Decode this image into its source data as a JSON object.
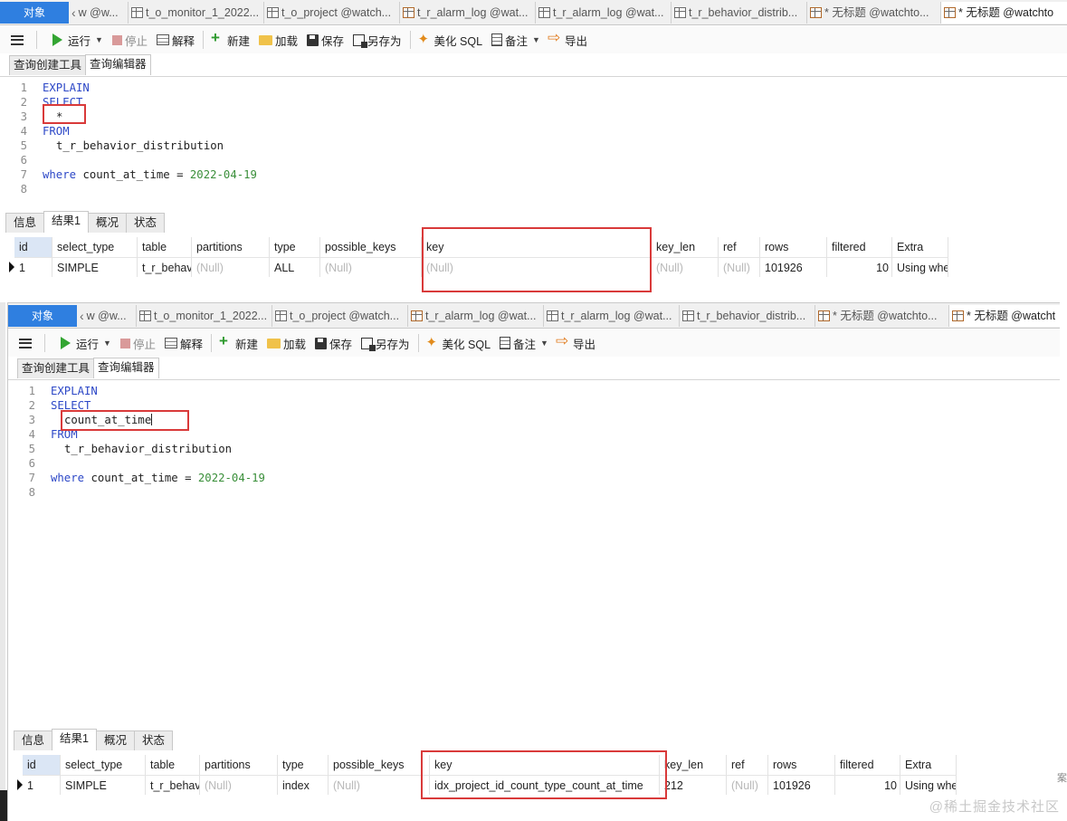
{
  "panel_top": {
    "object_tab": "对象",
    "tabs": [
      {
        "label": "w @w...",
        "icon": "back-chevron-icon"
      },
      {
        "label": "t_o_monitor_1_2022...",
        "icon": "table-icon"
      },
      {
        "label": "t_o_project @watch...",
        "icon": "table-icon"
      },
      {
        "label": "t_r_alarm_log @wat...",
        "icon": "query-icon"
      },
      {
        "label": "t_r_alarm_log @wat...",
        "icon": "table-icon"
      },
      {
        "label": "t_r_behavior_distrib...",
        "icon": "table-icon"
      },
      {
        "label": "* 无标题 @watchto...",
        "icon": "query-icon"
      },
      {
        "label": "* 无标题 @watchto",
        "icon": "query-icon"
      }
    ],
    "toolbar": {
      "run": "运行",
      "stop": "停止",
      "explain": "解释",
      "new": "新建",
      "load": "加载",
      "save": "保存",
      "save_as": "另存为",
      "beautify": "美化 SQL",
      "note": "备注",
      "export": "导出"
    },
    "sub_tabs": [
      "查询创建工具",
      "查询编辑器"
    ],
    "code": {
      "l1": "EXPLAIN",
      "l2": "SELECT",
      "l3": "*",
      "l4": "FROM",
      "l5": "t_r_behavior_distribution",
      "l7_kw": "where",
      "l7_col": "count_at_time =",
      "l7_date": "2022-04-19"
    },
    "line_numbers": [
      "1",
      "2",
      "3",
      "4",
      "5",
      "6",
      "7",
      "8"
    ],
    "result_tabs": [
      "信息",
      "结果1",
      "概况",
      "状态"
    ],
    "columns": [
      "id",
      "select_type",
      "table",
      "partitions",
      "type",
      "possible_keys",
      "key",
      "key_len",
      "ref",
      "rows",
      "filtered",
      "Extra"
    ],
    "row": {
      "id": "1",
      "select_type": "SIMPLE",
      "table": "t_r_behavi",
      "partitions": "(Null)",
      "type": "ALL",
      "possible_keys": "(Null)",
      "key": "(Null)",
      "key_len": "(Null)",
      "ref": "(Null)",
      "rows": "101926",
      "filtered": "10",
      "extra": "Using whe"
    }
  },
  "panel_bottom": {
    "object_tab": "对象",
    "tabs": [
      {
        "label": "w @w...",
        "icon": "back-chevron-icon"
      },
      {
        "label": "t_o_monitor_1_2022...",
        "icon": "table-icon"
      },
      {
        "label": "t_o_project @watch...",
        "icon": "table-icon"
      },
      {
        "label": "t_r_alarm_log @wat...",
        "icon": "query-icon"
      },
      {
        "label": "t_r_alarm_log @wat...",
        "icon": "table-icon"
      },
      {
        "label": "t_r_behavior_distrib...",
        "icon": "table-icon"
      },
      {
        "label": "* 无标题 @watchto...",
        "icon": "query-icon"
      },
      {
        "label": "* 无标题 @watcht",
        "icon": "query-icon"
      }
    ],
    "toolbar": {
      "run": "运行",
      "stop": "停止",
      "explain": "解释",
      "new": "新建",
      "load": "加载",
      "save": "保存",
      "save_as": "另存为",
      "beautify": "美化 SQL",
      "note": "备注",
      "export": "导出"
    },
    "sub_tabs": [
      "查询创建工具",
      "查询编辑器"
    ],
    "code": {
      "l1": "EXPLAIN",
      "l2": "SELECT",
      "l3": "count_at_time",
      "l4": "FROM",
      "l5": "t_r_behavior_distribution",
      "l7_kw": "where",
      "l7_col": "count_at_time =",
      "l7_date": "2022-04-19"
    },
    "line_numbers": [
      "1",
      "2",
      "3",
      "4",
      "5",
      "6",
      "7",
      "8"
    ],
    "result_tabs": [
      "信息",
      "结果1",
      "概况",
      "状态"
    ],
    "columns": [
      "id",
      "select_type",
      "table",
      "partitions",
      "type",
      "possible_keys",
      "key",
      "key_len",
      "ref",
      "rows",
      "filtered",
      "Extra"
    ],
    "row": {
      "id": "1",
      "select_type": "SIMPLE",
      "table": "t_r_behavi",
      "partitions": "(Null)",
      "type": "index",
      "possible_keys": "(Null)",
      "key": "idx_project_id_count_type_count_at_time",
      "key_len": "212",
      "ref": "(Null)",
      "rows": "101926",
      "filtered": "10",
      "extra": "Using whe"
    }
  },
  "right_fragment": "案",
  "watermark": "@稀土掘金技术社区",
  "colors": {
    "accent_blue": "#2f7fe0",
    "highlight_red": "#d93a3a",
    "keyword": "#2d48c7",
    "date_literal": "#3a8f3a"
  }
}
